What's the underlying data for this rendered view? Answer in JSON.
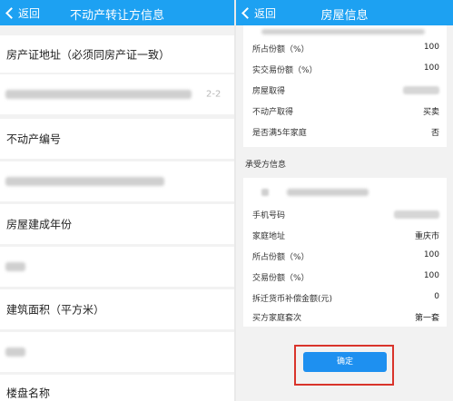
{
  "left": {
    "back_label": "返回",
    "title": "不动产转让方信息",
    "fields": [
      {
        "label": "房产证地址（必须同房产证一致）"
      },
      {
        "value_suffix": "2-2"
      },
      {
        "label": "不动产编号"
      },
      {
        "value_suffix": ""
      },
      {
        "label": "房屋建成年份"
      },
      {
        "value_suffix": ""
      },
      {
        "label": "建筑面积（平方米）"
      },
      {
        "value_suffix": ""
      },
      {
        "label": "楼盘名称"
      }
    ]
  },
  "right": {
    "back_label": "返回",
    "title": "房屋信息",
    "seller_rows": [
      {
        "label": "所占份额（%）",
        "value": "100"
      },
      {
        "label": "实交易份额（%）",
        "value": "100"
      },
      {
        "label": "房屋取得",
        "value": ""
      },
      {
        "label": "不动产取得",
        "value": "买卖"
      },
      {
        "label": "是否满5年家庭",
        "value": "否"
      }
    ],
    "section_title": "承受方信息",
    "buyer_rows": [
      {
        "label": "手机号码",
        "value": ""
      },
      {
        "label": "家庭地址",
        "value": "重庆市"
      },
      {
        "label": "所占份额（%）",
        "value": "100"
      },
      {
        "label": "交易份额（%）",
        "value": "100"
      },
      {
        "label": "拆迁货币补偿金额(元)",
        "value": "0"
      },
      {
        "label": "买方家庭套次",
        "value": "第一套"
      }
    ],
    "confirm_label": "确定"
  },
  "colors": {
    "nav": "#1da1f2",
    "button": "#1e90f0",
    "highlight": "#d9342b"
  }
}
